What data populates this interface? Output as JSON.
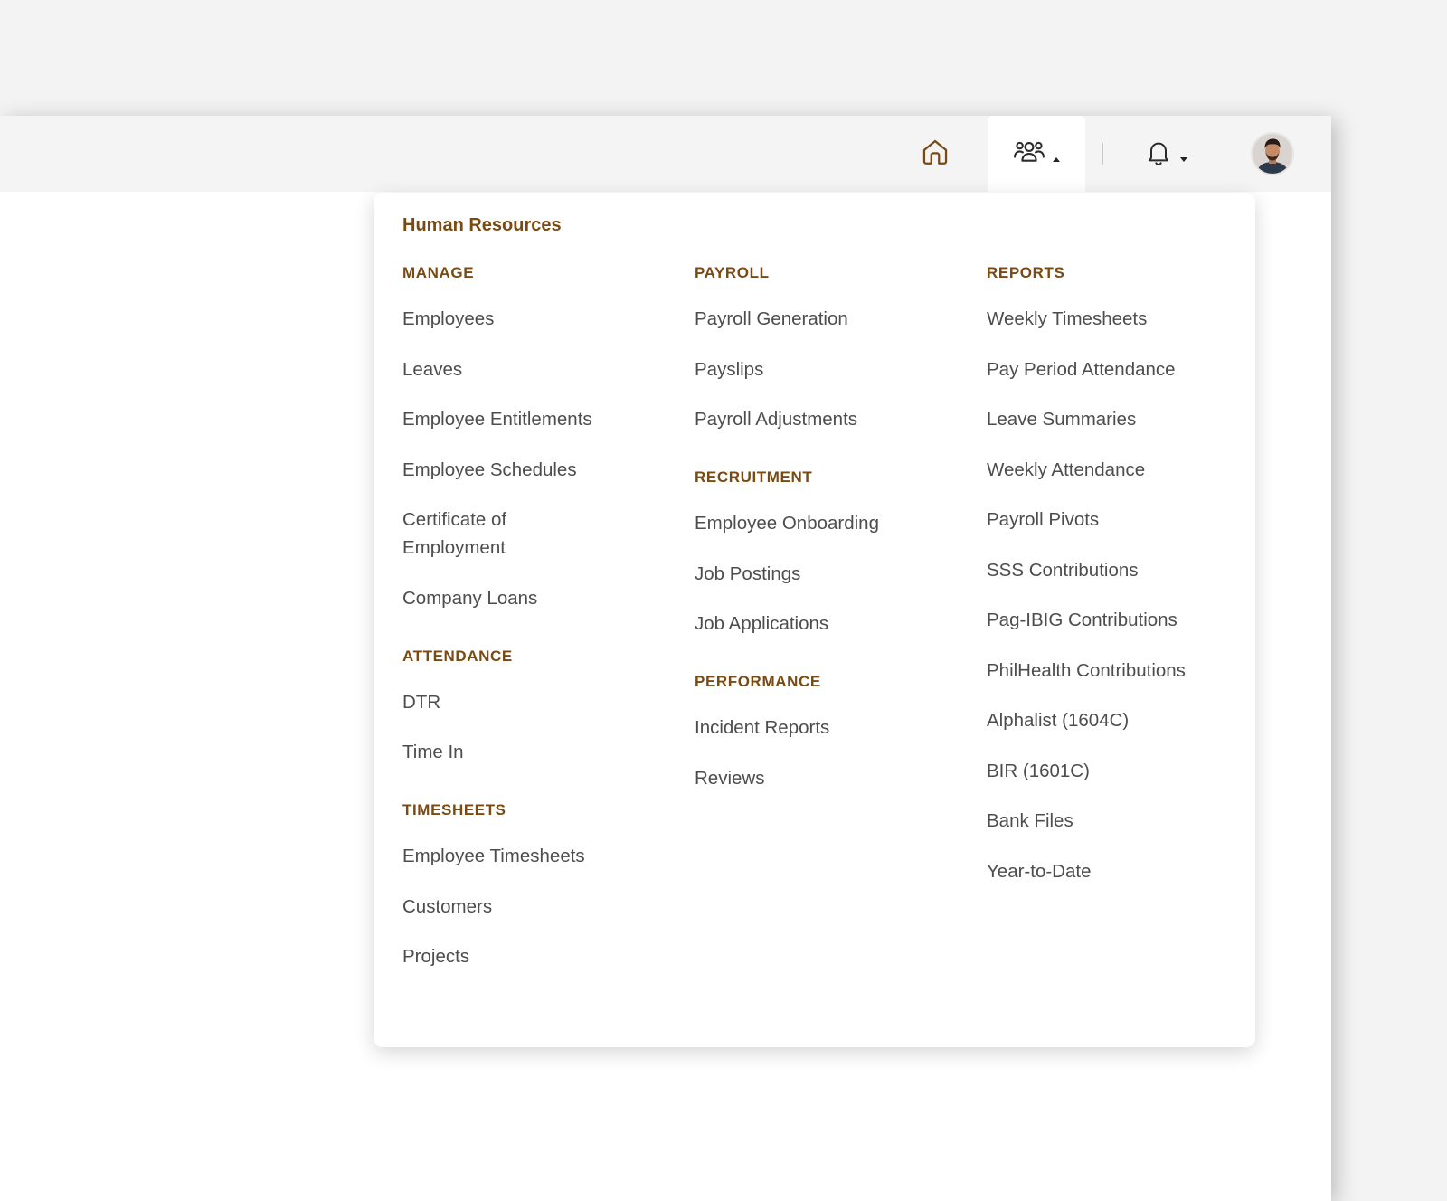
{
  "colors": {
    "accent": "#7a4a12",
    "item_text": "#4d4d4d",
    "topbar_bg": "#f4f4f4"
  },
  "topbar": {
    "icons": [
      "home-icon",
      "people-icon",
      "caret-up-icon",
      "bell-icon",
      "caret-down-icon",
      "avatar"
    ]
  },
  "dropdown": {
    "title": "Human Resources",
    "columns": [
      {
        "sections": [
          {
            "heading": "MANAGE",
            "items": [
              "Employees",
              "Leaves",
              "Employee Entitlements",
              "Employee Schedules",
              "Certificate of Employment",
              "Company Loans"
            ]
          },
          {
            "heading": "ATTENDANCE",
            "items": [
              "DTR",
              "Time In"
            ]
          },
          {
            "heading": "TIMESHEETS",
            "items": [
              "Employee Timesheets",
              "Customers",
              "Projects"
            ]
          }
        ]
      },
      {
        "sections": [
          {
            "heading": "PAYROLL",
            "items": [
              "Payroll Generation",
              "Payslips",
              "Payroll Adjustments"
            ]
          },
          {
            "heading": "RECRUITMENT",
            "items": [
              "Employee Onboarding",
              "Job Postings",
              "Job Applications"
            ]
          },
          {
            "heading": "PERFORMANCE",
            "items": [
              "Incident Reports",
              "Reviews"
            ]
          }
        ]
      },
      {
        "sections": [
          {
            "heading": "REPORTS",
            "items": [
              "Weekly Timesheets",
              "Pay Period Attendance",
              "Leave Summaries",
              "Weekly Attendance",
              "Payroll Pivots",
              "SSS Contributions",
              "Pag-IBIG Contributions",
              "PhilHealth Contributions",
              "Alphalist (1604C)",
              "BIR (1601C)",
              "Bank Files",
              "Year-to-Date"
            ]
          }
        ]
      }
    ]
  }
}
